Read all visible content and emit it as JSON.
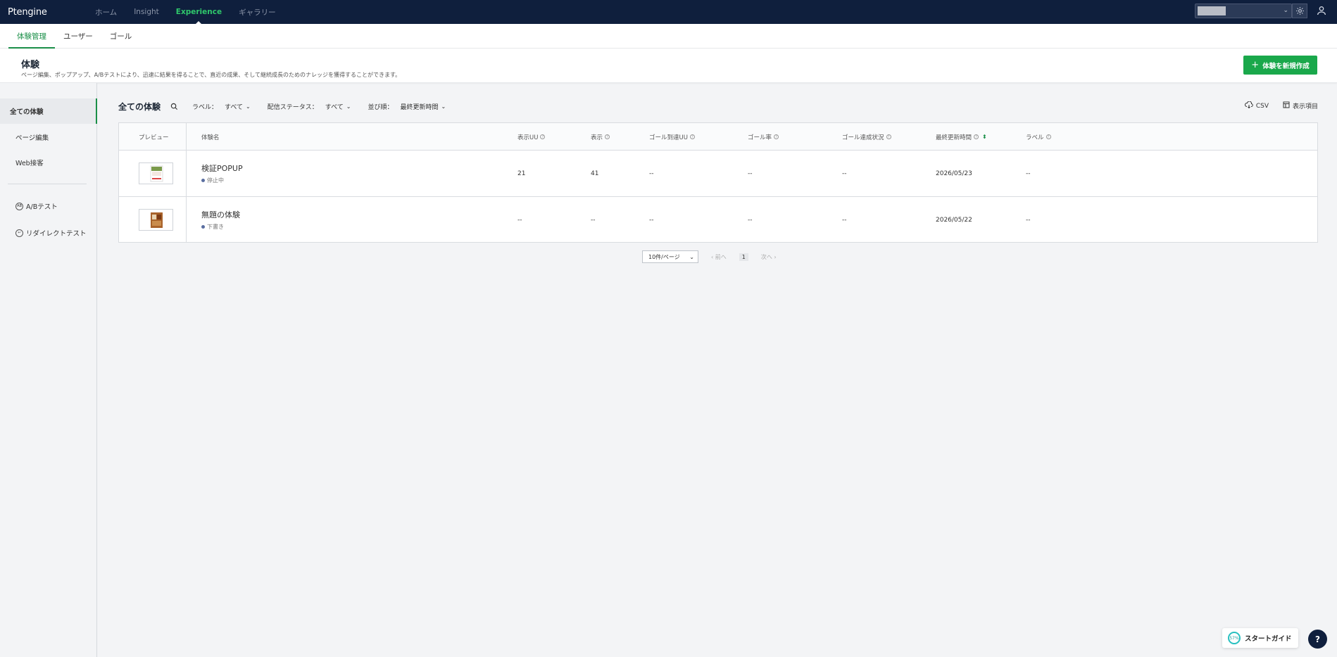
{
  "app": {
    "logo": "Ptengine"
  },
  "topnav": {
    "items": [
      {
        "label": "ホーム"
      },
      {
        "label": "Insight"
      },
      {
        "label": "Experience"
      },
      {
        "label": "ギャラリー"
      }
    ],
    "active_index": 2
  },
  "subnav": {
    "tabs": [
      {
        "label": "体験管理"
      },
      {
        "label": "ユーザー"
      },
      {
        "label": "ゴール"
      }
    ]
  },
  "header": {
    "title": "体験",
    "description": "ページ編集、ポップアップ、A/Bテストにより、迅速に結果を得ることで、直近の成果、そして継続成長のためのナレッジを獲得することができます。",
    "create_button": "体験を新規作成"
  },
  "sidebar": {
    "items": [
      {
        "label": "全ての体験"
      },
      {
        "label": "ページ編集"
      },
      {
        "label": "Web接客"
      },
      {
        "label": "A/Bテスト",
        "icon": "ab-icon"
      },
      {
        "label": "リダイレクトテスト",
        "icon": "redirect-icon"
      }
    ]
  },
  "toolbar": {
    "title": "全ての体験",
    "filters": [
      {
        "label": "ラベル：",
        "value": "すべて"
      },
      {
        "label": "配信ステータス：",
        "value": "すべて"
      },
      {
        "label": "並び順：",
        "value": "最終更新時間"
      }
    ],
    "csv_label": "CSV",
    "columns_label": "表示項目"
  },
  "table": {
    "headers": [
      "プレビュー",
      "体験名",
      "表示UU",
      "表示",
      "ゴール到達UU",
      "ゴール率",
      "ゴール達成状況",
      "最終更新時間",
      "ラベル"
    ],
    "rows": [
      {
        "name": "検証POPUP",
        "status": "停止中",
        "uu": "21",
        "views": "41",
        "goal_uu": "--",
        "goal_rate": "--",
        "goal_status": "--",
        "updated": "2026/05/23",
        "label": "--"
      },
      {
        "name": "無題の体験",
        "status": "下書き",
        "uu": "--",
        "views": "--",
        "goal_uu": "--",
        "goal_rate": "--",
        "goal_status": "--",
        "updated": "2026/05/22",
        "label": "--"
      }
    ]
  },
  "pagination": {
    "page_size": "10件/ページ",
    "prev": "‹ 前へ",
    "current": "1",
    "next": "次へ ›"
  },
  "guide": {
    "progress": "57%",
    "label": "スタートガイド"
  },
  "help": {
    "label": "?"
  },
  "colors": {
    "nav_bg": "#0f1f3d",
    "accent": "#1a8f48",
    "active_nav": "#2fc76b",
    "primary_button": "#1aa84b"
  }
}
